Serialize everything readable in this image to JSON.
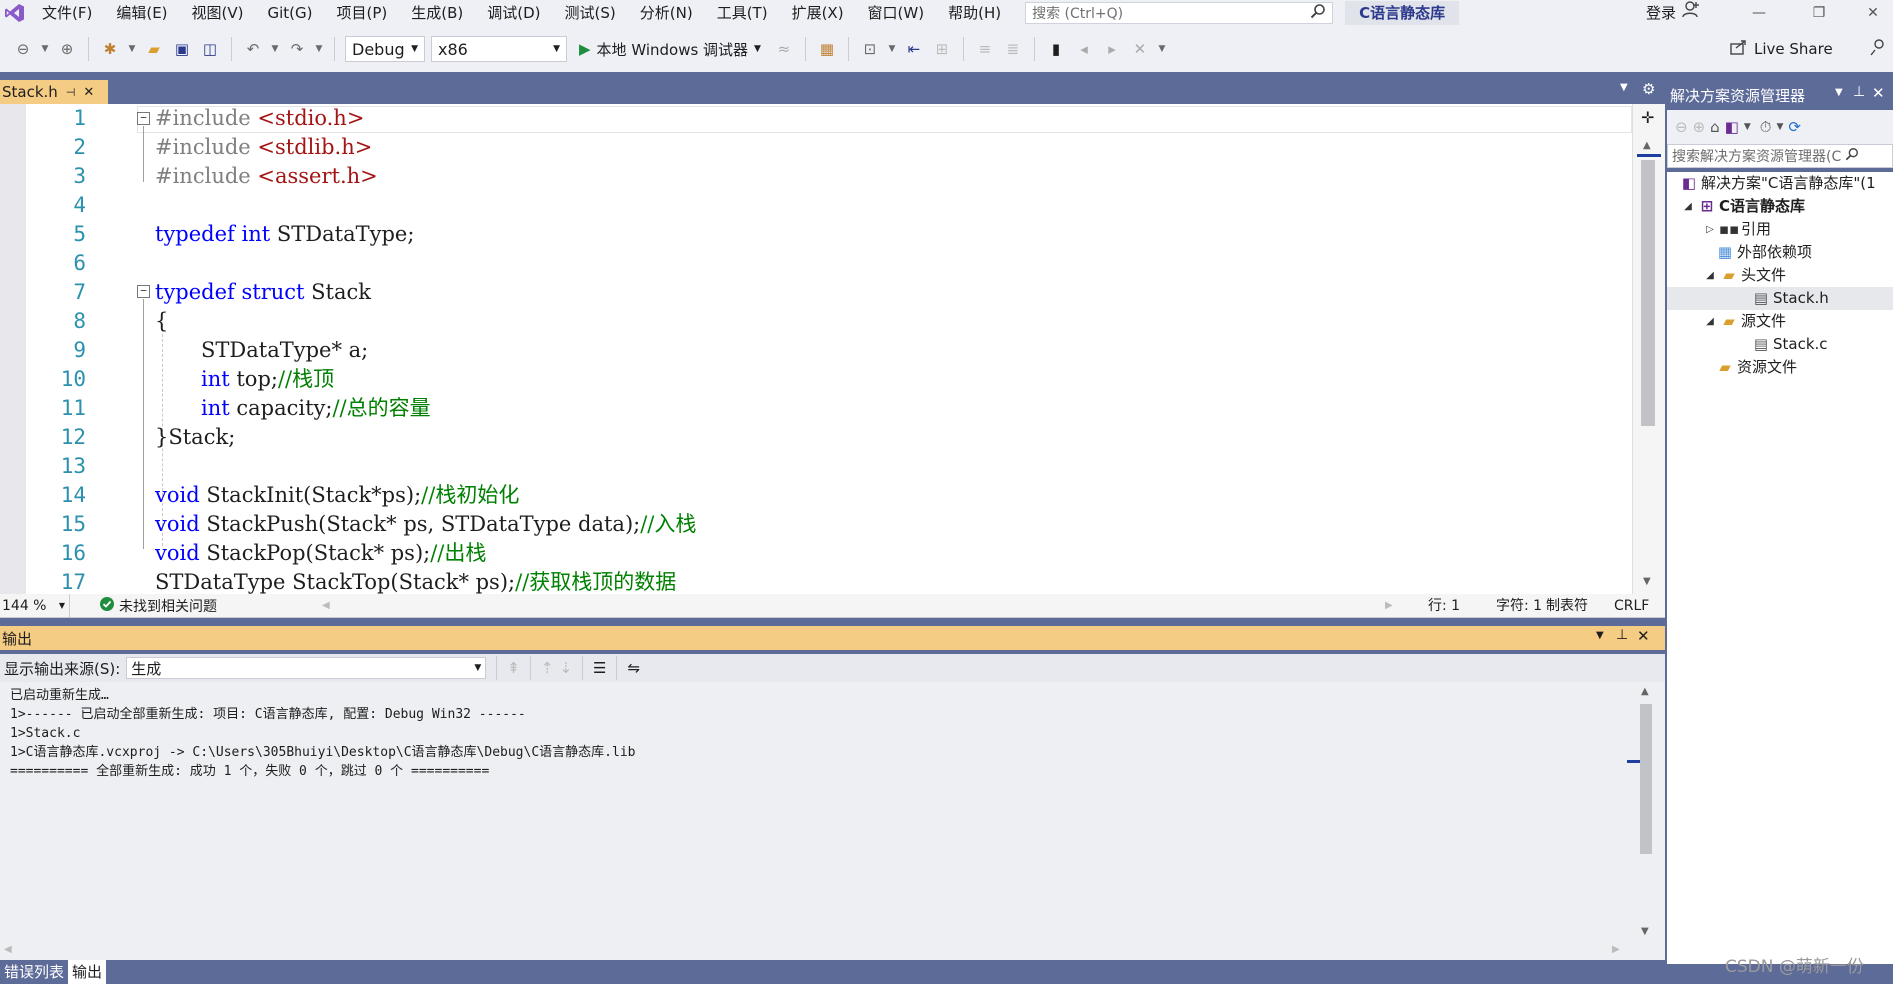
{
  "menu": {
    "items": [
      "文件(F)",
      "编辑(E)",
      "视图(V)",
      "Git(G)",
      "项目(P)",
      "生成(B)",
      "调试(D)",
      "测试(S)",
      "分析(N)",
      "工具(T)",
      "扩展(X)",
      "窗口(W)",
      "帮助(H)"
    ],
    "search_placeholder": "搜索 (Ctrl+Q)",
    "solution_title": "C语言静态库",
    "login": "登录"
  },
  "toolbar": {
    "config": "Debug",
    "platform": "x86",
    "run_label": "本地 Windows 调试器",
    "live_share": "Live Share"
  },
  "editor": {
    "tab_name": "Stack.h",
    "line_numbers": [
      "1",
      "2",
      "3",
      "4",
      "5",
      "6",
      "7",
      "8",
      "9",
      "10",
      "11",
      "12",
      "13",
      "14",
      "15",
      "16",
      "17"
    ],
    "zoom": "144 %",
    "issues": "未找到相关问题",
    "status_line": "行: 1",
    "status_col": "字符: 1",
    "status_tabs": "制表符",
    "status_eol": "CRLF"
  },
  "code": {
    "l1a": "#include ",
    "l1b": "<stdio.h>",
    "l2a": "#include ",
    "l2b": "<stdlib.h>",
    "l3a": "#include ",
    "l3b": "<assert.h>",
    "l5a": "typedef",
    "l5b": " ",
    "l5c": "int",
    "l5d": " STDataType;",
    "l7a": "typedef",
    "l7b": " ",
    "l7c": "struct",
    "l7d": " Stack",
    "l8": "{",
    "l9": "STDataType* a;",
    "l10a": "int",
    "l10b": " top;",
    "l10c": "//栈顶",
    "l11a": "int",
    "l11b": " capacity;",
    "l11c": "//总的容量",
    "l12": "}Stack;",
    "l14a": "void",
    "l14b": " StackInit(Stack*ps);",
    "l14c": "//栈初始化",
    "l15a": "void",
    "l15b": " StackPush(Stack* ps, STDataType data);",
    "l15c": "//入栈",
    "l16a": "void",
    "l16b": " StackPop(Stack* ps);",
    "l16c": "//出栈",
    "l17a": "STDataType StackTop(Stack* ps);",
    "l17b": "//获取栈顶的数据"
  },
  "output": {
    "title": "输出",
    "source_label": "显示输出来源(S):",
    "source_value": "生成",
    "lines": [
      "已启动重新生成…",
      "1>------ 已启动全部重新生成: 项目: C语言静态库, 配置: Debug Win32 ------",
      "1>Stack.c",
      "1>C语言静态库.vcxproj -> C:\\Users\\305Bhuiyi\\Desktop\\C语言静态库\\Debug\\C语言静态库.lib",
      "========== 全部重新生成: 成功 1 个，失败 0 个，跳过 0 个 =========="
    ]
  },
  "bottom_tabs": [
    "错误列表",
    "输出"
  ],
  "solution_explorer": {
    "title": "解决方案资源管理器",
    "search_placeholder": "搜索解决方案资源管理器(C",
    "solution": "解决方案\"C语言静态库\"(1",
    "project": "C语言静态库",
    "references": "引用",
    "external_deps": "外部依赖项",
    "header_files": "头文件",
    "header_stack": "Stack.h",
    "source_files": "源文件",
    "source_stack": "Stack.c",
    "resource_files": "资源文件"
  },
  "watermark": "CSDN @萌新一份",
  "colors": {
    "frame": "#5d6b99",
    "active_tab": "#f5cc84",
    "keyword": "#0000ff",
    "comment": "#008000",
    "include_string": "#a31515",
    "line_number": "#2b91af"
  }
}
